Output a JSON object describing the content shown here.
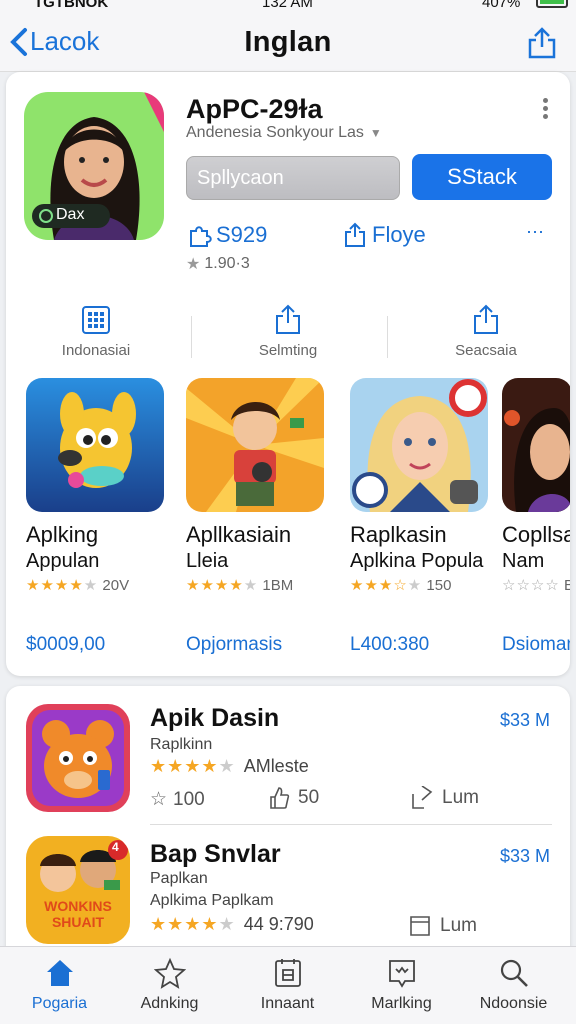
{
  "status_bar": {
    "carrier": "TGTBNOK",
    "time": "132 AM",
    "battery": "407%"
  },
  "nav": {
    "back_label": "Lacok",
    "title": "Inglan"
  },
  "app": {
    "title": "ApPC-29ɫa",
    "subtitle": "Andenesia Sonkyour Las",
    "icon_badge": "Dax",
    "field_placeholder": "Spllycaon",
    "get_label": "SStack",
    "price": "S929",
    "follow_label": "Floye",
    "more_label": "⋯",
    "rating": "1.90·3"
  },
  "actions": [
    {
      "label": "Indonasiai",
      "icon": "grid-icon"
    },
    {
      "label": "Selmting",
      "icon": "share-icon"
    },
    {
      "label": "Seacsaia",
      "icon": "share-icon"
    }
  ],
  "featured": [
    {
      "title": "Aplking",
      "subtitle": "Appulan",
      "stars": 4,
      "count": "20V",
      "price": "$0009,00"
    },
    {
      "title": "Apllkasiain",
      "subtitle": "Lleia",
      "stars": 4,
      "count": "1BM",
      "price": "Opjormasis"
    },
    {
      "title": "Raplkasin",
      "subtitle": "Aplkina Popula",
      "stars": 3.5,
      "count": "150",
      "price": "L400:380"
    },
    {
      "title": "Copllsa",
      "subtitle": "Nam",
      "stars": 0,
      "count": "B",
      "price": "Dsioman"
    }
  ],
  "list": [
    {
      "name": "Apik Dasin",
      "price": "$33 M",
      "sub1": "Raplkinn",
      "stars": 4,
      "rating_text": "AMleste",
      "meta1": "100",
      "meta2": "50",
      "meta3": "Lum"
    },
    {
      "name": "Bap Snvlar",
      "price": "$33 M",
      "sub1": "Paplkan",
      "sub2": "Aplkima Paplkam",
      "stars": 4,
      "rating_text": "44 9:790",
      "meta3": "Lum",
      "icon_text": "WONKINS SHUAIT",
      "icon_badge": "4"
    }
  ],
  "tabs": [
    {
      "label": "Pogaria",
      "icon": "home-icon",
      "active": true
    },
    {
      "label": "Adnking",
      "icon": "star-icon",
      "active": false
    },
    {
      "label": "Innaant",
      "icon": "calendar-icon",
      "active": false
    },
    {
      "label": "Marlking",
      "icon": "badge-icon",
      "active": false
    },
    {
      "label": "Ndoonsie",
      "icon": "search-icon",
      "active": false
    }
  ],
  "colors": {
    "accent": "#1a73e8",
    "link": "#1a6fd3",
    "star": "#f5a623"
  }
}
